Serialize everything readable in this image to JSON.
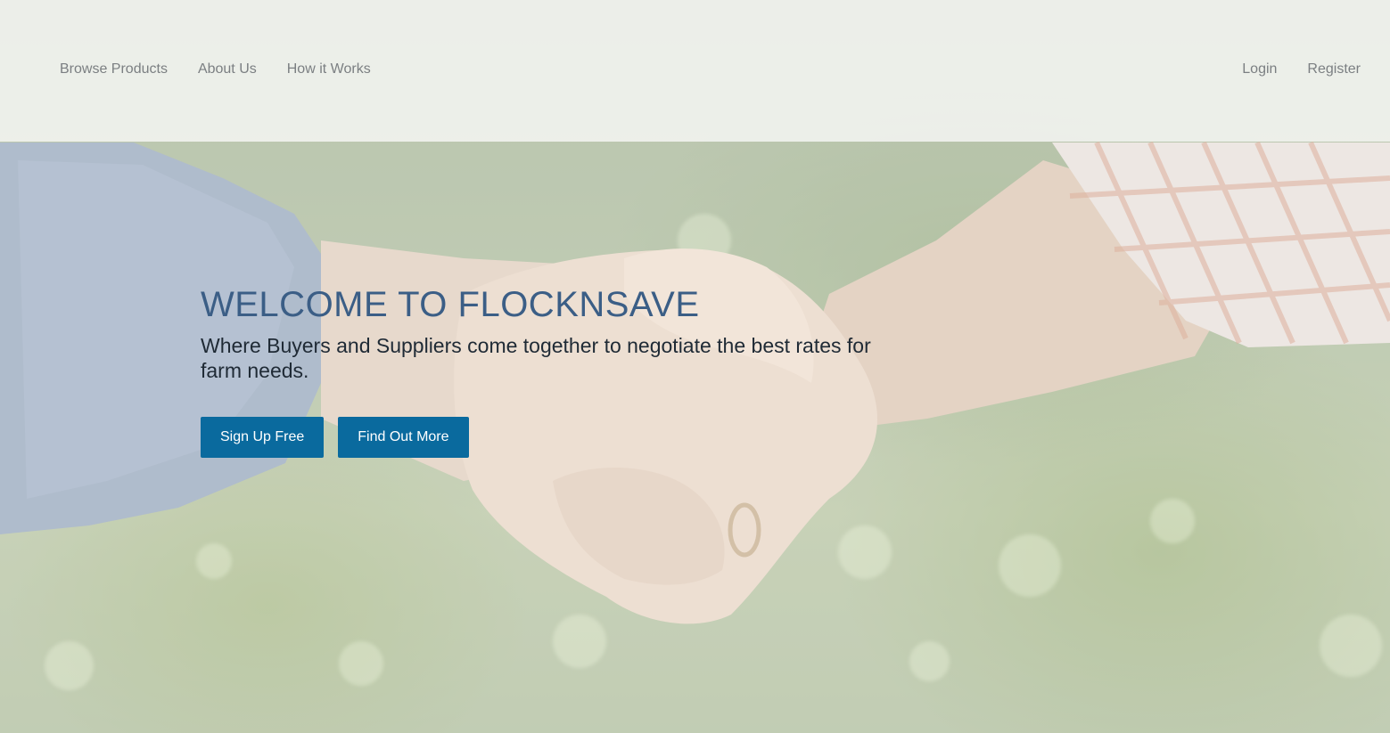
{
  "header": {
    "nav_left": [
      {
        "label": "Browse Products"
      },
      {
        "label": "About Us"
      },
      {
        "label": "How it Works"
      }
    ],
    "nav_right": [
      {
        "label": "Login"
      },
      {
        "label": "Register"
      }
    ]
  },
  "hero": {
    "title": "WELCOME TO FLOCKNSAVE",
    "subtitle": "Where Buyers and Suppliers come together to negotiate the best rates for farm needs.",
    "buttons": {
      "sign_up": "Sign Up Free",
      "find_out_more": "Find Out More"
    }
  },
  "background": {
    "image": "handshake-photo"
  },
  "colors": {
    "title": "#3b5e86",
    "button": "#0a6a9e",
    "nav_text": "#7b7f82"
  }
}
